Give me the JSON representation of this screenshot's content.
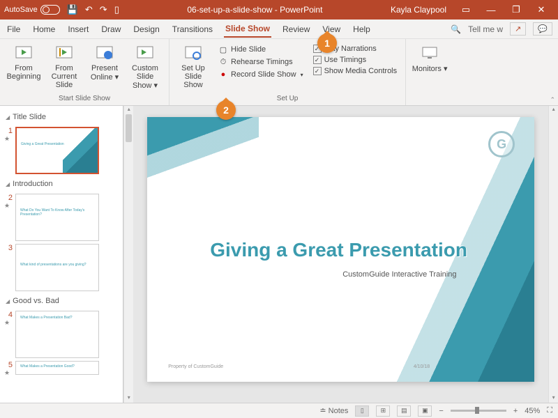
{
  "titlebar": {
    "autosave": "AutoSave",
    "doc": "06-set-up-a-slide-show - PowerPoint",
    "user": "Kayla Claypool"
  },
  "tabs": {
    "file": "File",
    "home": "Home",
    "insert": "Insert",
    "draw": "Draw",
    "design": "Design",
    "transitions": "Transitions",
    "slideshow": "Slide Show",
    "review": "Review",
    "view": "View",
    "help": "Help",
    "tellme": "Tell me w"
  },
  "ribbon": {
    "start": {
      "from_beginning": "From Beginning",
      "from_current": "From Current Slide",
      "present_online": "Present Online",
      "custom_show": "Custom Slide Show",
      "label": "Start Slide Show"
    },
    "setup": {
      "setup_show": "Set Up Slide Show",
      "hide_slide": "Hide Slide",
      "rehearse": "Rehearse Timings",
      "record": "Record Slide Show",
      "play_narrations": "Play Narrations",
      "use_timings": "Use Timings",
      "show_media": "Show Media Controls",
      "label": "Set Up"
    },
    "monitors": {
      "monitors": "Monitors"
    }
  },
  "callouts": {
    "one": "1",
    "two": "2"
  },
  "sections": {
    "title": "Title Slide",
    "intro": "Introduction",
    "gvb": "Good vs. Bad"
  },
  "thumbs": {
    "n1": "1",
    "n2": "2",
    "n3": "3",
    "n4": "4",
    "n5": "5",
    "t1": "Giving a Great Presentation",
    "t2": "What Do You Want To Know After Today's Presentation?",
    "t3": "What kind of presentations are you giving?",
    "t4": "What Makes a Presentation Bad?",
    "t5": "What Makes a Presentation Good?"
  },
  "slide": {
    "title": "Giving a Great Presentation",
    "subtitle": "CustomGuide Interactive Training",
    "footer": "Property of CustomGuide",
    "date": "4/10/18",
    "logo": "G"
  },
  "status": {
    "notes": "Notes",
    "zoom": "45%",
    "plus": "+",
    "minus": "−"
  }
}
